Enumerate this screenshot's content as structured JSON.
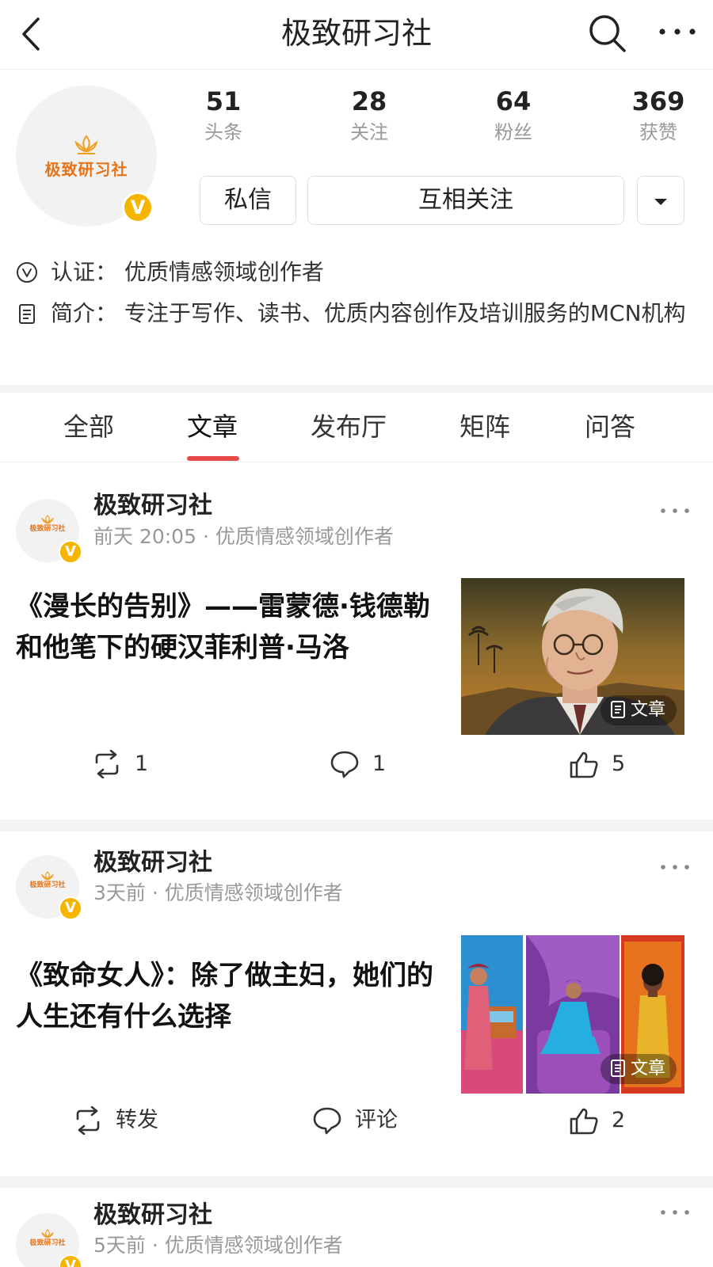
{
  "header": {
    "title": "极致研习社"
  },
  "profile": {
    "logo_text": "极致研习社",
    "verified_mark": "V",
    "stats": [
      {
        "value": "51",
        "label": "头条"
      },
      {
        "value": "28",
        "label": "关注"
      },
      {
        "value": "64",
        "label": "粉丝"
      },
      {
        "value": "369",
        "label": "获赞"
      }
    ],
    "buttons": {
      "message": "私信",
      "follow": "互相关注"
    },
    "certification": "认证：  优质情感领域创作者",
    "intro": "简介：  专注于写作、读书、优质内容创作及培训服务的MCN机构"
  },
  "tabs": [
    "全部",
    "文章",
    "发布厅",
    "矩阵",
    "问答"
  ],
  "active_tab": "文章",
  "feed": [
    {
      "author": "极致研习社",
      "meta": "前天 20:05 · 优质情感领域创作者",
      "title": "《漫长的告别》——雷蒙德·钱德勒和他笔下的硬汉菲利普·马洛",
      "thumb_tag": "文章",
      "repost": "1",
      "comment": "1",
      "like": "5"
    },
    {
      "author": "极致研习社",
      "meta": "3天前 · 优质情感领域创作者",
      "title": "《致命女人》：除了做主妇，她们的人生还有什么选择",
      "thumb_tag": "文章",
      "repost": "转发",
      "comment": "评论",
      "like": "2"
    },
    {
      "author": "极致研习社",
      "meta": "5天前 · 优质情感领域创作者"
    }
  ],
  "colors": {
    "accent": "#e84a4a",
    "brand_orange": "#e8741a",
    "badge": "#f6b500"
  }
}
